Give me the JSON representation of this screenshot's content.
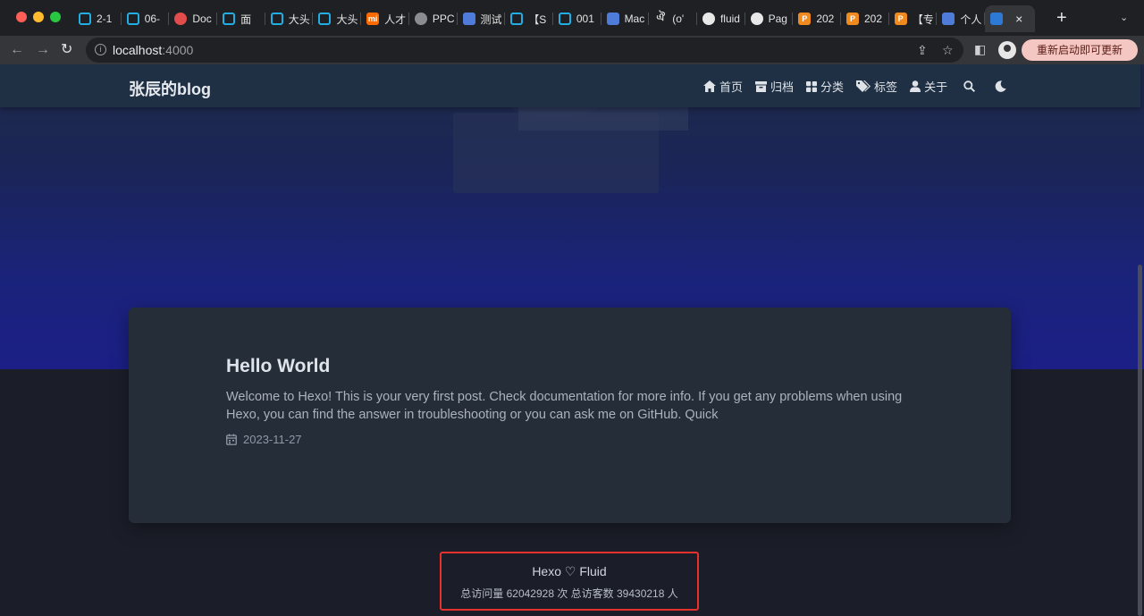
{
  "browser": {
    "tabs": [
      {
        "label": "2-1",
        "favicon": "bilibili-icon"
      },
      {
        "label": "06-",
        "favicon": "bilibili-icon"
      },
      {
        "label": "Doc",
        "favicon": "red-circle-icon"
      },
      {
        "label": "面",
        "favicon": "bilibili-icon"
      },
      {
        "label": "大头",
        "favicon": "bilibili-icon"
      },
      {
        "label": "大头",
        "favicon": "bilibili-icon"
      },
      {
        "label": "人才",
        "favicon": "mi-icon"
      },
      {
        "label": "PPC",
        "favicon": "globe-icon"
      },
      {
        "label": "测试",
        "favicon": "doc-icon"
      },
      {
        "label": "【S",
        "favicon": "bilibili-icon"
      },
      {
        "label": "001",
        "favicon": "bilibili-icon"
      },
      {
        "label": "Mac",
        "favicon": "doc-icon"
      },
      {
        "label": "(o'",
        "favicon": "symbol-icon"
      },
      {
        "label": "fluid",
        "favicon": "github-icon"
      },
      {
        "label": "Pag",
        "favicon": "github-icon"
      },
      {
        "label": "202",
        "favicon": "ppt-icon"
      },
      {
        "label": "202",
        "favicon": "ppt-icon"
      },
      {
        "label": "【专",
        "favicon": "ppt-icon"
      },
      {
        "label": "个人",
        "favicon": "doc-icon"
      }
    ],
    "active_tab": {
      "favicon": "fluid-icon",
      "close": "×"
    },
    "new_tab": "+",
    "url_host": "localhost",
    "url_port": ":4000",
    "update_button": "重新启动即可更新"
  },
  "site": {
    "brand": "张辰的blog",
    "nav": [
      {
        "label": "首页",
        "icon": "home-icon"
      },
      {
        "label": "归档",
        "icon": "archive-icon"
      },
      {
        "label": "分类",
        "icon": "grid-icon"
      },
      {
        "label": "标签",
        "icon": "tags-icon"
      },
      {
        "label": "关于",
        "icon": "user-icon"
      }
    ]
  },
  "post": {
    "title": "Hello World",
    "excerpt": "Welcome to Hexo! This is your very first post. Check documentation for more info. If you get any problems when using Hexo, you can find the answer in troubleshooting or you can ask me on GitHub. Quick",
    "date": "2023-11-27"
  },
  "footer": {
    "line1": "Hexo ♡ Fluid",
    "line2": "总访问量 62042928 次  总访客数 39430218 人"
  },
  "colors": {
    "highlight_border": "#e5322d",
    "navbar": "#1f3044",
    "card": "#252d38"
  }
}
